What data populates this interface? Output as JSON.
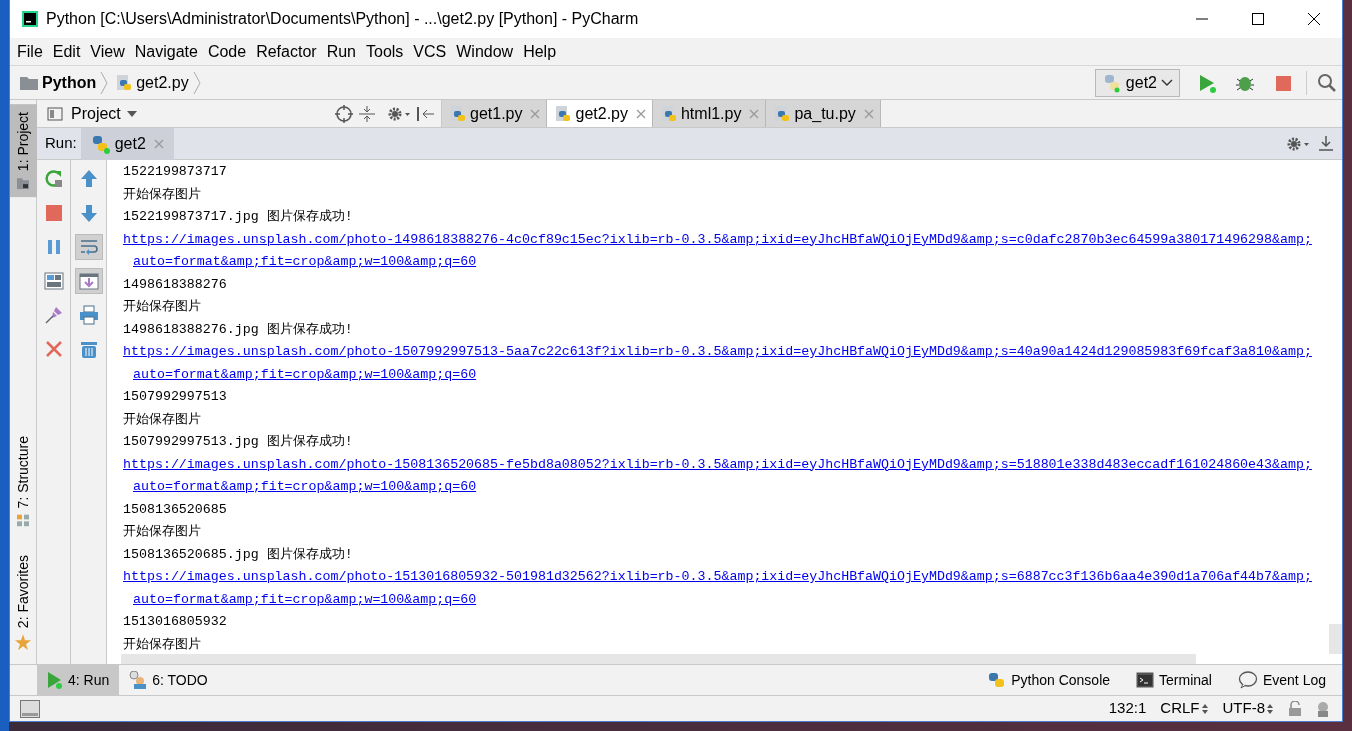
{
  "window": {
    "title": "Python [C:\\Users\\Administrator\\Documents\\Python] - ...\\get2.py [Python] - PyCharm"
  },
  "menu": [
    {
      "label": "File"
    },
    {
      "label": "Edit"
    },
    {
      "label": "View"
    },
    {
      "label": "Navigate"
    },
    {
      "label": "Code"
    },
    {
      "label": "Refactor"
    },
    {
      "label": "Run"
    },
    {
      "label": "Tools"
    },
    {
      "label": "VCS"
    },
    {
      "label": "Window"
    },
    {
      "label": "Help"
    }
  ],
  "breadcrumb": [
    {
      "label": "Python",
      "kind": "folder"
    },
    {
      "label": "get2.py",
      "kind": "file"
    }
  ],
  "run_config": {
    "label": "get2"
  },
  "left_tool_tabs": [
    {
      "label": "1: Project",
      "selected": true,
      "kind": "project"
    },
    {
      "label": "7: Structure",
      "selected": false,
      "kind": "structure"
    },
    {
      "label": "2: Favorites",
      "selected": false,
      "kind": "favorites"
    }
  ],
  "project_panel": {
    "title": "Project"
  },
  "editor_tabs": [
    {
      "label": "get1.py",
      "selected": false
    },
    {
      "label": "get2.py",
      "selected": true
    },
    {
      "label": "html1.py",
      "selected": false
    },
    {
      "label": "pa_tu.py",
      "selected": false
    }
  ],
  "run_panel": {
    "title": "Run:",
    "tabs": [
      {
        "label": "get2",
        "selected": true
      }
    ]
  },
  "run_toolbar": [
    [
      {
        "kind": "rerun",
        "on": false
      },
      {
        "kind": "stop",
        "on": false
      },
      {
        "kind": "pause",
        "on": false
      },
      {
        "kind": "layout",
        "on": false
      },
      {
        "kind": "pin",
        "on": false
      },
      {
        "kind": "close",
        "on": false
      }
    ],
    [
      {
        "kind": "up",
        "on": false
      },
      {
        "kind": "down",
        "on": false
      },
      {
        "kind": "soft-wrap",
        "on": true
      },
      {
        "kind": "scroll-end",
        "on": true
      },
      {
        "kind": "print",
        "on": false
      },
      {
        "kind": "trash",
        "on": false
      }
    ]
  ],
  "console": [
    {
      "kind": "text",
      "text": "1522199873717"
    },
    {
      "kind": "text",
      "text": "开始保存图片"
    },
    {
      "kind": "text",
      "text": "1522199873717.jpg 图片保存成功!"
    },
    {
      "kind": "link",
      "parts": [
        "https://images.unsplash.com/photo-1498618388276-4c0cf89c15ec?ixlib=rb-0.3.5&amp;ixid=eyJhcHBfaWQiOjEyMDd9&amp;s=c0dafc2870b3ec64599a380171496298&amp;",
        "auto=format&amp;fit=crop&amp;w=100&amp;q=60"
      ]
    },
    {
      "kind": "text",
      "text": "1498618388276"
    },
    {
      "kind": "text",
      "text": "开始保存图片"
    },
    {
      "kind": "text",
      "text": "1498618388276.jpg 图片保存成功!"
    },
    {
      "kind": "link",
      "parts": [
        "https://images.unsplash.com/photo-1507992997513-5aa7c22c613f?ixlib=rb-0.3.5&amp;ixid=eyJhcHBfaWQiOjEyMDd9&amp;s=40a90a1424d129085983f69fcaf3a810&amp;",
        "auto=format&amp;fit=crop&amp;w=100&amp;q=60"
      ]
    },
    {
      "kind": "text",
      "text": "1507992997513"
    },
    {
      "kind": "text",
      "text": "开始保存图片"
    },
    {
      "kind": "text",
      "text": "1507992997513.jpg 图片保存成功!"
    },
    {
      "kind": "link",
      "parts": [
        "https://images.unsplash.com/photo-1508136520685-fe5bd8a08052?ixlib=rb-0.3.5&amp;ixid=eyJhcHBfaWQiOjEyMDd9&amp;s=518801e338d483eccadf161024860e43&amp;",
        "auto=format&amp;fit=crop&amp;w=100&amp;q=60"
      ]
    },
    {
      "kind": "text",
      "text": "1508136520685"
    },
    {
      "kind": "text",
      "text": "开始保存图片"
    },
    {
      "kind": "text",
      "text": "1508136520685.jpg 图片保存成功!"
    },
    {
      "kind": "link",
      "parts": [
        "https://images.unsplash.com/photo-1513016805932-501981d32562?ixlib=rb-0.3.5&amp;ixid=eyJhcHBfaWQiOjEyMDd9&amp;s=6887cc3f136b6aa4e390d1a706af44b7&amp;",
        "auto=format&amp;fit=crop&amp;w=100&amp;q=60"
      ]
    },
    {
      "kind": "text",
      "text": "1513016805932"
    },
    {
      "kind": "text",
      "text": "开始保存图片"
    }
  ],
  "bottom_tabs": [
    {
      "label": "4: Run",
      "selected": true,
      "kind": "run"
    },
    {
      "label": "6: TODO",
      "selected": false,
      "kind": "todo"
    }
  ],
  "bottom_right_tools": [
    {
      "label": "Python Console",
      "kind": "python"
    },
    {
      "label": "Terminal",
      "kind": "terminal"
    },
    {
      "label": "Event Log",
      "kind": "log"
    }
  ],
  "status_bar": {
    "position": "132:1",
    "line_separator": "CRLF",
    "encoding": "UTF-8"
  }
}
